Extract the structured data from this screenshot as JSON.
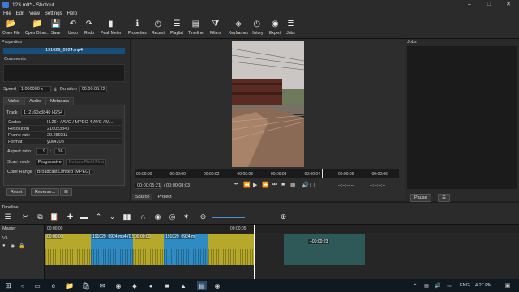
{
  "window": {
    "title": "123.mlt* - Shotcut"
  },
  "menu": [
    "File",
    "Edit",
    "View",
    "Settings",
    "Help"
  ],
  "toolbar": [
    {
      "label": "Open File",
      "icon": "folder-open-icon",
      "glyph": "📂"
    },
    {
      "label": "Open Other...",
      "icon": "folder-plus-icon",
      "glyph": "📁"
    },
    {
      "label": "Save",
      "icon": "save-icon",
      "glyph": "💾"
    },
    {
      "label": "Undo",
      "icon": "undo-icon",
      "glyph": "↶"
    },
    {
      "label": "Redo",
      "icon": "redo-icon",
      "glyph": "↷"
    },
    {
      "label": "Peak Meter",
      "icon": "peak-meter-icon",
      "glyph": "▮"
    },
    {
      "label": "Properties",
      "icon": "info-icon",
      "glyph": "ℹ"
    },
    {
      "label": "Recent",
      "icon": "clock-icon",
      "glyph": "◷"
    },
    {
      "label": "Playlist",
      "icon": "playlist-icon",
      "glyph": "☰"
    },
    {
      "label": "Timeline",
      "icon": "timeline-icon",
      "glyph": "▤"
    },
    {
      "label": "Filters",
      "icon": "filter-icon",
      "glyph": "⧩"
    },
    {
      "label": "Keyframes",
      "icon": "keyframes-icon",
      "glyph": "◈"
    },
    {
      "label": "History",
      "icon": "history-icon",
      "glyph": "◴"
    },
    {
      "label": "Export",
      "icon": "export-icon",
      "glyph": "◉"
    },
    {
      "label": "Jobs",
      "icon": "jobs-icon",
      "glyph": "≣"
    }
  ],
  "properties": {
    "header": "Properties",
    "clip_name": "191029_0924.mp4",
    "comments_label": "Comments:",
    "speed_label": "Speed",
    "speed_value": "1.000000 x",
    "duration_label": "Duration",
    "duration_value": "00:00:05:22",
    "tabs": [
      "Video",
      "Audio",
      "Metadata"
    ],
    "track_label": "Track",
    "track_value": "1: 2160x3840 H264",
    "info": [
      {
        "k": "Codec",
        "v": "H.264 / AVC / MPEG-4 AVC / M..."
      },
      {
        "k": "Resolution",
        "v": "2160x3840"
      },
      {
        "k": "Frame rate",
        "v": "29.289211"
      },
      {
        "k": "Format",
        "v": "yuv420p"
      }
    ],
    "aspect_label": "Aspect ratio",
    "aspect_w": "9",
    "aspect_sep": ":",
    "aspect_h": "16",
    "scan_label": "Scan mode",
    "scan_value": "Progressive",
    "field_order": "Bottom Field First",
    "color_label": "Color Range",
    "color_value": "Broadcast Limited (MPEG)",
    "reset": "Reset",
    "reverse": "Reverse...",
    "more": "☰"
  },
  "viewer": {
    "ruler_ticks": [
      "00:00:00",
      "00:00:00",
      "00:00:02",
      "00:00:03",
      "00:00:03",
      "00:00:04",
      "00:00:06",
      "00:00:06"
    ],
    "timecode": "00:00:05:21",
    "total": "/ 00:00:08:03",
    "in_point": "--:--:--:--",
    "out_point": "--:--:--:--",
    "source_tab": "Source",
    "project_tab": "Project",
    "playhead_fraction": 0.71
  },
  "jobs": {
    "header": "Jobs",
    "pause": "Pause",
    "menu": "☰"
  },
  "timeline": {
    "label": "Timeline",
    "master": "Master",
    "track": "V1",
    "ruler": [
      "00:00:00",
      "00:00:05"
    ],
    "clips": [
      {
        "label": "00:00:00",
        "name": "",
        "color": "#b5a82a"
      },
      {
        "label": "191029_0924.mp4 (0.5x)",
        "name": "",
        "color": "#2f8bc2"
      },
      {
        "label": "00:00:00",
        "name": "",
        "color": "#b5a82a"
      },
      {
        "label": "191029_0924.m",
        "name": "",
        "color": "#2f8bc2"
      },
      {
        "label": "",
        "name": "",
        "color": "#b5a82a"
      }
    ],
    "drag_badge": "+00:00:23"
  },
  "taskbar": {
    "lang": "ENG",
    "time": "4:27 PM"
  }
}
